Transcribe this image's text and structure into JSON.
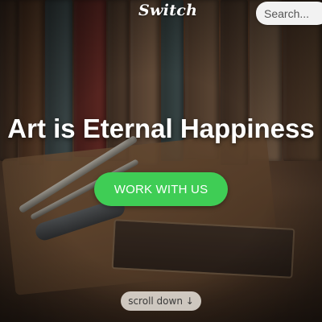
{
  "nav": {
    "logo": "Switch",
    "search_placeholder": "Search..."
  },
  "hero": {
    "headline": "Art is Eternal Happiness",
    "cta_label": "WORK WITH US",
    "scroll_label": "scroll down ↓"
  },
  "colors": {
    "cta_green": "#3fcd55",
    "search_bg": "#f2f2f2"
  }
}
